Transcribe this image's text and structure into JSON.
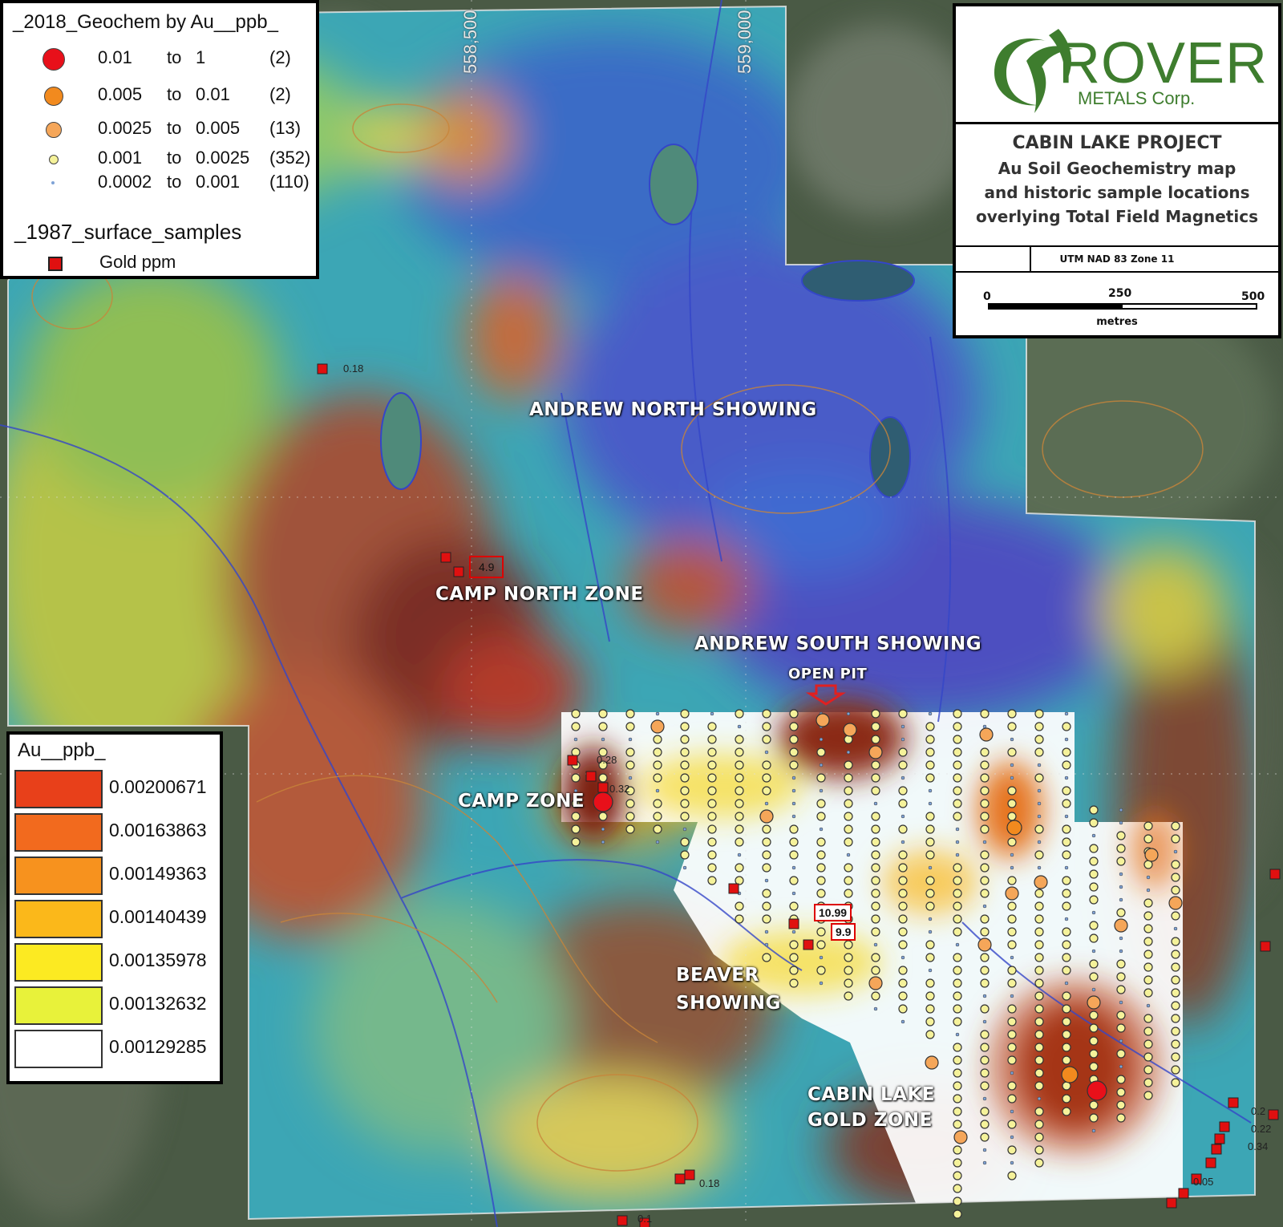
{
  "map": {
    "grid_labels": [
      "558,500",
      "559,000"
    ],
    "zones": [
      {
        "id": "andrew-north",
        "text": "ANDREW NORTH SHOWING"
      },
      {
        "id": "camp-north",
        "text": "CAMP NORTH ZONE"
      },
      {
        "id": "andrew-south",
        "text": "ANDREW SOUTH SHOWING"
      },
      {
        "id": "open-pit",
        "text": "OPEN PIT"
      },
      {
        "id": "camp-zone",
        "text": "CAMP ZONE"
      },
      {
        "id": "beaver-1",
        "text": "BEAVER"
      },
      {
        "id": "beaver-2",
        "text": "SHOWING"
      },
      {
        "id": "cabin-1",
        "text": "CABIN LAKE"
      },
      {
        "id": "cabin-2",
        "text": "GOLD ZONE"
      }
    ],
    "sample_values": [
      "0.18",
      "0.28",
      "0.32",
      "0.18",
      "0.05",
      "0.2",
      "0.22",
      "0.34",
      "0.05",
      "0.1"
    ],
    "callouts": [
      "4.9",
      "10.99",
      "9.9"
    ]
  },
  "legend_geochem": {
    "title": "_2018_Geochem by Au__ppb_",
    "classes": [
      {
        "low": "0.01",
        "to": "to",
        "high": "1",
        "count": "(2)",
        "color": "#e8101a"
      },
      {
        "low": "0.005",
        "to": "to",
        "high": "0.01",
        "count": "(2)",
        "color": "#f28a1e"
      },
      {
        "low": "0.0025",
        "to": "to",
        "high": "0.005",
        "count": "(13)",
        "color": "#f5a659"
      },
      {
        "low": "0.001",
        "to": "to",
        "high": "0.0025",
        "count": "(352)",
        "color": "#f5f29a"
      },
      {
        "low": "0.0002",
        "to": "to",
        "high": "0.001",
        "count": "(110)",
        "color": "#7fa3d6"
      }
    ],
    "surface_title": "_1987_surface_samples",
    "surface_label": "Gold ppm",
    "surface_color": "#e01010"
  },
  "legend_gradient": {
    "title": "Au__ppb_",
    "stops": [
      {
        "value": "0.00200671",
        "color": "#e8401a"
      },
      {
        "value": "0.00163863",
        "color": "#f26a1e"
      },
      {
        "value": "0.00149363",
        "color": "#f7921e"
      },
      {
        "value": "0.00140439",
        "color": "#fbb81a"
      },
      {
        "value": "0.00135978",
        "color": "#fcea22"
      },
      {
        "value": "0.00132632",
        "color": "#e8f23a"
      },
      {
        "value": "0.00129285",
        "color": "#ffffff"
      }
    ]
  },
  "title_block": {
    "logo_main": "ROVER",
    "logo_sub": "METALS Corp.",
    "logo_color": "#3e7d2e",
    "project": "CABIN LAKE PROJECT",
    "subtitle_1": "Au Soil Geochemistry map",
    "subtitle_2": "and historic sample locations",
    "subtitle_3": "overlying Total Field Magnetics",
    "datum": "UTM NAD 83 Zone 11",
    "scale": {
      "ticks": [
        "0",
        "250",
        "500"
      ],
      "unit": "metres"
    }
  }
}
